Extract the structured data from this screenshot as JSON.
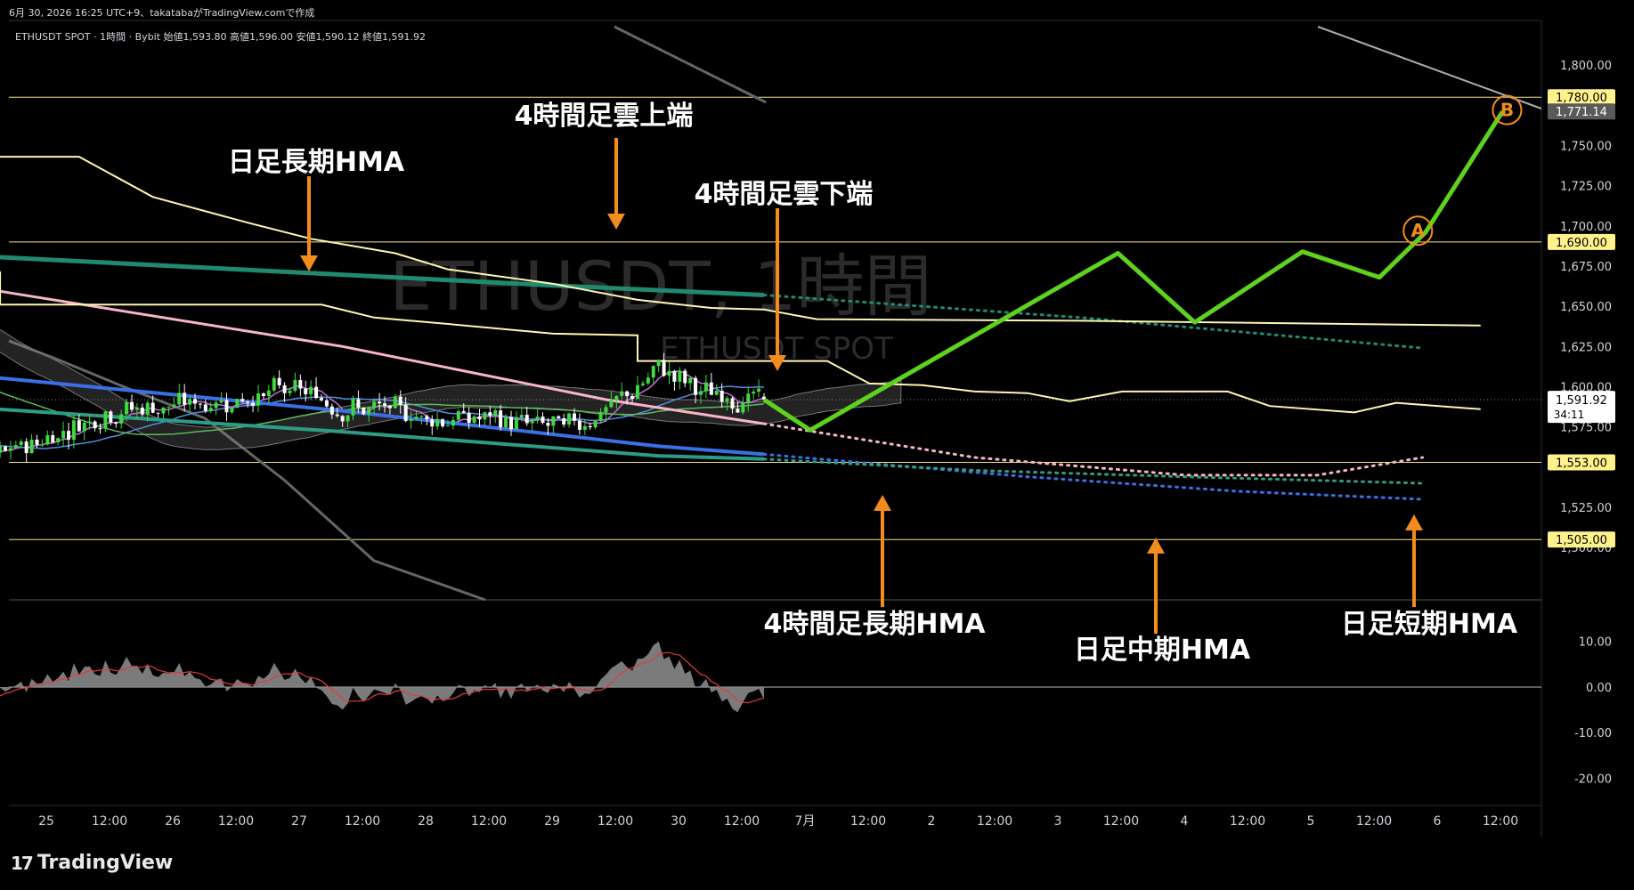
{
  "header": {
    "published": "6月 30, 2026 16:25 UTC+9、takatabaがTradingView.comで作成",
    "legend": "ETHUSDT SPOT · 1時間 · Bybit  始値1,593.80  高値1,596.00  安値1,590.12  終値1,591.92"
  },
  "watermark": {
    "title": "ETHUSDT, 1時間",
    "subtitle": "ETHUSDT SPOT"
  },
  "brand": {
    "name": "TradingView"
  },
  "colors": {
    "background": "#000000",
    "hline": "#f5e48a",
    "cloud_line": "#fff6b0",
    "scenario": "#5ed21e",
    "arrow": "#f28c1c",
    "daily_long_hma": "#1f8a70",
    "daily_mid_hma": "#3a6fe6",
    "daily_short_hma": "#f8b4c8",
    "h4_long_hma": "#2e9c84",
    "candle_up": "#3fd93f",
    "candle_down": "#ffffff"
  },
  "chart_data": {
    "type": "candlestick",
    "symbol": "ETHUSDT SPOT",
    "timeframe": "1時間",
    "exchange": "Bybit",
    "ohlc_last": {
      "open": 1593.8,
      "high": 1596.0,
      "low": 1590.12,
      "close": 1591.92
    },
    "ylim": [
      1478,
      1810
    ],
    "osc_ylim": [
      -25,
      16
    ],
    "x_ticks": [
      "25",
      "12:00",
      "26",
      "12:00",
      "27",
      "12:00",
      "28",
      "12:00",
      "29",
      "12:00",
      "30",
      "12:00",
      "7月",
      "12:00",
      "2",
      "12:00",
      "3",
      "12:00",
      "4",
      "12:00",
      "5",
      "12:00",
      "6",
      "12:00"
    ],
    "y_ticks": [
      "1,800.00",
      "1,775.00",
      "1,750.00",
      "1,725.00",
      "1,700.00",
      "1,675.00",
      "1,650.00",
      "1,625.00",
      "1,600.00",
      "1,575.00",
      "1,525.00",
      "1,500.00"
    ],
    "osc_ticks": [
      "10.00",
      "0.00",
      "-10.00",
      "-20.00"
    ],
    "price_labels": [
      {
        "label": "1,780.00",
        "value": 1780,
        "style": "hline"
      },
      {
        "label": "1,771.14",
        "value": 1771.14,
        "style": "gray"
      },
      {
        "label": "1,690.00",
        "value": 1690,
        "style": "hline"
      },
      {
        "label": "1,553.00",
        "value": 1553,
        "style": "hline"
      },
      {
        "label": "1,505.00",
        "value": 1505,
        "style": "hline"
      }
    ],
    "current_price": {
      "label": "1,591.92",
      "value": 1591.92,
      "countdown": "34:11"
    },
    "horizontal_lines": [
      1780,
      1690,
      1553,
      1505
    ],
    "scenario_path": {
      "t": [
        0,
        3,
        23,
        28,
        35,
        40,
        43,
        48
      ],
      "y": [
        1592,
        1573,
        1683,
        1640,
        1684,
        1668,
        1696,
        1771
      ]
    },
    "scenario_points": [
      {
        "label": "A",
        "t": 42.5,
        "y": 1697
      },
      {
        "label": "B",
        "t": 48.3,
        "y": 1772
      }
    ],
    "annotations": [
      {
        "text": "日足長期HMA",
        "points_to": "daily_long_hma"
      },
      {
        "text": "4時間足雲上端",
        "points_to": "h4_cloud_upper"
      },
      {
        "text": "4時間足雲下端",
        "points_to": "h4_cloud_lower"
      },
      {
        "text": "4時間足長期HMA",
        "points_to": "h4_long_hma"
      },
      {
        "text": "日足中期HMA",
        "points_to": "daily_mid_hma"
      },
      {
        "text": "日足短期HMA",
        "points_to": "daily_short_hma"
      }
    ]
  }
}
